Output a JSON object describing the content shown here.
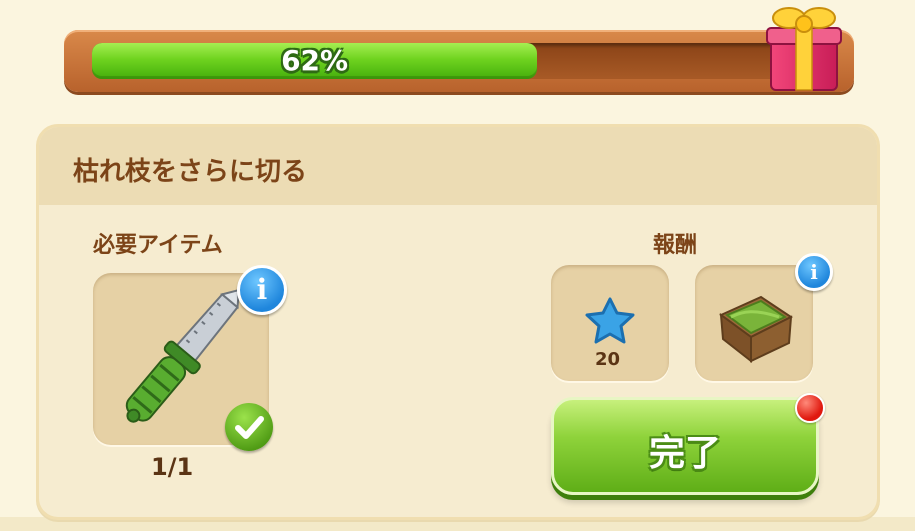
{
  "progress": {
    "value": 0.62,
    "label": "62%"
  },
  "task": {
    "title": "枯れ枝をさらに切る",
    "required_label": "必要アイテム",
    "required_item": {
      "icon": "knife-icon",
      "count": "1/1",
      "completed": true
    },
    "reward_label": "報酬",
    "rewards": [
      {
        "icon": "blue-star-icon",
        "amount": "20"
      },
      {
        "icon": "grass-crate-icon"
      }
    ],
    "complete_button": "完了"
  },
  "colors": {
    "progress_green": "#6fd31f",
    "frame_orange": "#c8743a",
    "title_brown": "#7c4418",
    "button_green": "#8fd33b",
    "info_blue": "#1f86dc",
    "notification_red": "#e0190f"
  }
}
